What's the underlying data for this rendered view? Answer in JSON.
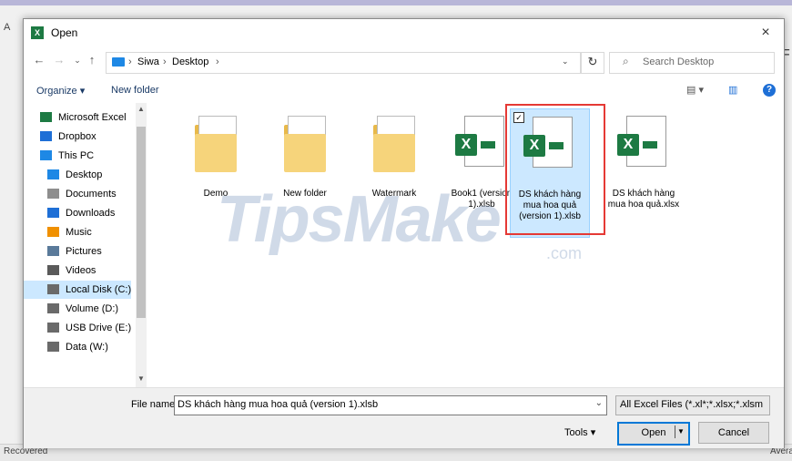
{
  "background": {
    "status_left": "Recovered",
    "status_right": "Avera",
    "left_letter": "A",
    "right_letter": "F"
  },
  "dialog": {
    "title": "Open",
    "close": "×"
  },
  "address": {
    "parts": [
      "Siwa",
      "Desktop"
    ],
    "separator": "›"
  },
  "search": {
    "placeholder": "Search Desktop",
    "icon": "⌕"
  },
  "toolbar": {
    "organize": "Organize ▾",
    "new_folder": "New folder",
    "help": "?"
  },
  "nav": [
    {
      "label": "Microsoft Excel",
      "icon": "excel-icon",
      "color": "#1d7a43"
    },
    {
      "label": "Dropbox",
      "icon": "dropbox-icon",
      "color": "#1e6fd6"
    },
    {
      "label": "This PC",
      "icon": "pc-icon",
      "color": "#1e88e5"
    },
    {
      "label": "Desktop",
      "icon": "desktop-icon",
      "color": "#1e88e5"
    },
    {
      "label": "Documents",
      "icon": "documents-icon",
      "color": "#8e8e8e"
    },
    {
      "label": "Downloads",
      "icon": "downloads-icon",
      "color": "#1e6fd6"
    },
    {
      "label": "Music",
      "icon": "music-icon",
      "color": "#f09000"
    },
    {
      "label": "Pictures",
      "icon": "pictures-icon",
      "color": "#5a7a9a"
    },
    {
      "label": "Videos",
      "icon": "videos-icon",
      "color": "#5a5a5a"
    },
    {
      "label": "Local Disk (C:)",
      "icon": "drive-icon",
      "color": "#6a6a6a"
    },
    {
      "label": "Volume (D:)",
      "icon": "drive-icon",
      "color": "#6a6a6a"
    },
    {
      "label": "USB Drive (E:)",
      "icon": "usb-icon",
      "color": "#6a6a6a"
    },
    {
      "label": "Data (W:)",
      "icon": "drive-icon",
      "color": "#6a6a6a"
    }
  ],
  "files": [
    {
      "label": "Demo",
      "type": "folder"
    },
    {
      "label": "New folder",
      "type": "folder"
    },
    {
      "label": "Watermark",
      "type": "folder"
    },
    {
      "label": "Book1 (version 1).xlsb",
      "type": "xlsb"
    },
    {
      "label": "DS khách hàng mua hoa quả (version 1).xlsb",
      "type": "xlsb"
    },
    {
      "label": "DS khách hàng mua hoa quả.xlsx",
      "type": "xlsx"
    }
  ],
  "watermark": {
    "text": "TipsMake",
    "sub": ".com"
  },
  "bottom": {
    "file_name_label": "File name:",
    "file_name_value": "DS khách hàng mua hoa quả (version 1).xlsb",
    "file_type": "All Excel Files (*.xl*;*.xlsx;*.xlsm",
    "tools": "Tools",
    "open": "Open",
    "cancel": "Cancel"
  }
}
